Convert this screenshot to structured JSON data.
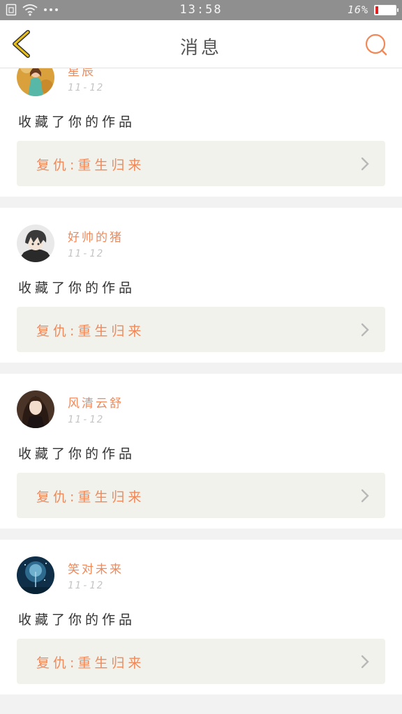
{
  "status_bar": {
    "time": "13:58",
    "battery_percent": "16%",
    "battery_level": 0.16,
    "icons": [
      "sim-icon",
      "wifi-icon",
      "more-dots-icon",
      "battery-icon"
    ]
  },
  "header": {
    "title": "消息",
    "back_icon": "chevron-left-icon",
    "search_icon": "search-icon",
    "accent_colors": {
      "back": "#e8c018",
      "search": "#f0895a"
    }
  },
  "notifications": [
    {
      "username": "星辰",
      "date": "11-12",
      "action": "收藏了你的作品",
      "work_title": "复仇:重生归来"
    },
    {
      "username": "好帅的猪",
      "date": "11-12",
      "action": "收藏了你的作品",
      "work_title": "复仇:重生归来"
    },
    {
      "username": "风清云舒",
      "date": "11-12",
      "action": "收藏了你的作品",
      "work_title": "复仇:重生归来"
    },
    {
      "username": "笑对未来",
      "date": "11-12",
      "action": "收藏了你的作品",
      "work_title": "复仇:重生归来"
    }
  ],
  "colors": {
    "accent": "#f0895a",
    "link_bg": "#f2f2ec",
    "divider": "#f2f2f2"
  }
}
